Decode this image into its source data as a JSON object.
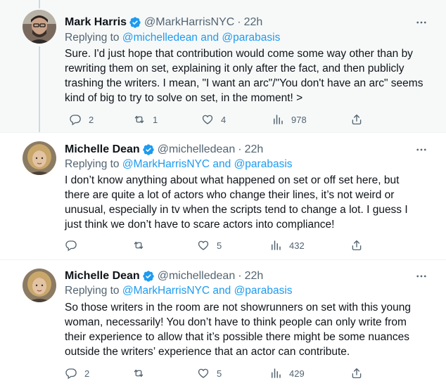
{
  "tweets": [
    {
      "name": "Mark Harris",
      "handle": "@MarkHarrisNYC",
      "dot": "·",
      "time": "22h",
      "replying_prefix": "Replying to ",
      "replying_targets": "@michelledean and @parabasis",
      "lines": [
        "Sure. I'd just hope that contribution would come some way other than by",
        "rewriting them on set, explaining it only after the fact, and then publicly",
        "trashing the writers. I mean, \"I want an arc\"/\"You don't have an arc\" seems",
        "kind of big to try to solve on set, in the moment! >"
      ],
      "replies": "2",
      "retweets": "1",
      "likes": "4",
      "views": "978"
    },
    {
      "name": "Michelle Dean",
      "handle": "@michelledean",
      "dot": "·",
      "time": "22h",
      "replying_prefix": "Replying to ",
      "replying_targets": "@MarkHarrisNYC and @parabasis",
      "lines": [
        "I don’t know anything about what happened on set or off set here, but",
        "there are quite a lot of actors who change their lines, it’s not weird or",
        "unusual, especially in tv when the scripts tend to change a lot. I guess I",
        "just think we don’t have to scare actors into compliance!"
      ],
      "replies": "",
      "retweets": "",
      "likes": "5",
      "views": "432"
    },
    {
      "name": "Michelle Dean",
      "handle": "@michelledean",
      "dot": "·",
      "time": "22h",
      "replying_prefix": "Replying to ",
      "replying_targets": "@MarkHarrisNYC and @parabasis",
      "lines": [
        "So those writers in the room are not showrunners on set with this young",
        "woman, necessarily! You don’t have to think people can only write from",
        "their experience to allow that it’s possible there might be some nuances",
        "outside the writers’ experience that an actor can contribute."
      ],
      "replies": "2",
      "retweets": "",
      "likes": "5",
      "views": "429"
    }
  ],
  "colors": {
    "accent": "#1d9bf0",
    "secondary_text": "#536471",
    "verified": "#1d9bf0",
    "highlight_bg": "#f7f9f9"
  },
  "icons": [
    "verified-badge-icon",
    "more-icon",
    "reply-icon",
    "retweet-icon",
    "like-icon",
    "views-icon",
    "share-icon"
  ]
}
